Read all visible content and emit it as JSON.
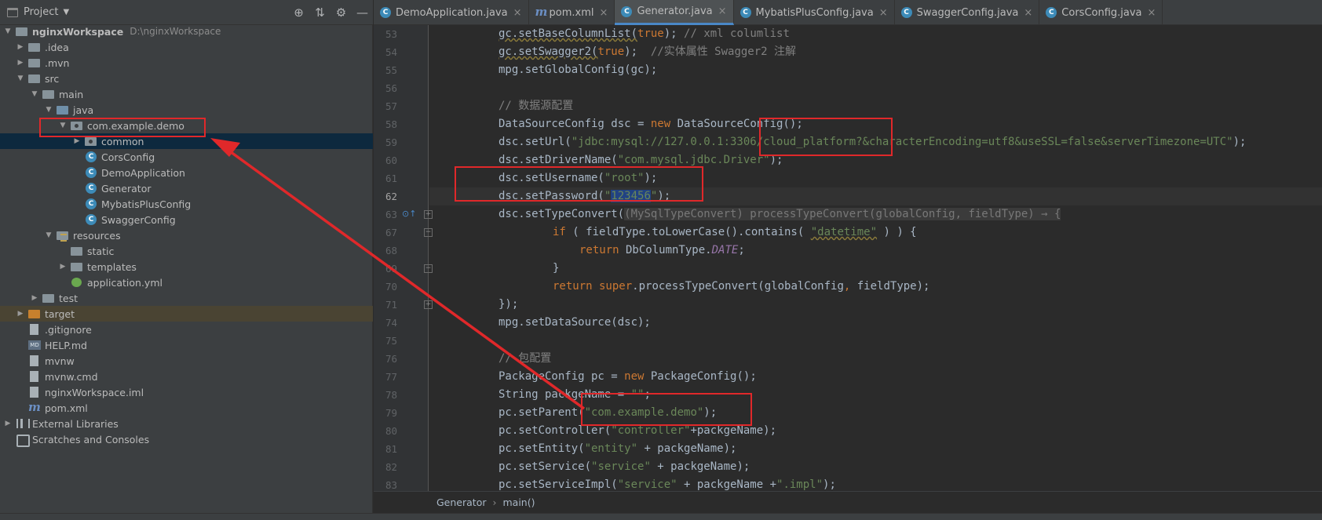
{
  "project_panel": {
    "title": "Project",
    "tools": [
      "locate-icon",
      "collapse-icon",
      "gear-icon",
      "minimize-icon"
    ]
  },
  "tree": [
    {
      "label": "nginxWorkspace",
      "sub": "D:\\nginxWorkspace"
    },
    {
      "label": ".idea"
    },
    {
      "label": ".mvn"
    },
    {
      "label": "src"
    },
    {
      "label": "main"
    },
    {
      "label": "java"
    },
    {
      "label": "com.example.demo"
    },
    {
      "label": "common"
    },
    {
      "label": "CorsConfig"
    },
    {
      "label": "DemoApplication"
    },
    {
      "label": "Generator"
    },
    {
      "label": "MybatisPlusConfig"
    },
    {
      "label": "SwaggerConfig"
    },
    {
      "label": "resources"
    },
    {
      "label": "static"
    },
    {
      "label": "templates"
    },
    {
      "label": "application.yml"
    },
    {
      "label": "test"
    },
    {
      "label": "target"
    },
    {
      "label": ".gitignore"
    },
    {
      "label": "HELP.md"
    },
    {
      "label": "mvnw"
    },
    {
      "label": "mvnw.cmd"
    },
    {
      "label": "nginxWorkspace.iml"
    },
    {
      "label": "pom.xml"
    },
    {
      "label": "External Libraries"
    },
    {
      "label": "Scratches and Consoles"
    }
  ],
  "tabs": [
    {
      "label": "DemoApplication.java"
    },
    {
      "label": "pom.xml"
    },
    {
      "label": "Generator.java"
    },
    {
      "label": "MybatisPlusConfig.java"
    },
    {
      "label": "SwaggerConfig.java"
    },
    {
      "label": "CorsConfig.java"
    }
  ],
  "line_numbers": [
    "53",
    "54",
    "55",
    "56",
    "57",
    "58",
    "59",
    "60",
    "61",
    "62",
    "63",
    "67",
    "68",
    "69",
    "70",
    "71",
    "74",
    "75",
    "76",
    "77",
    "78",
    "79",
    "80",
    "81",
    "82",
    "83"
  ],
  "code": {
    "l53a": "gc.setBaseColumnList(",
    "l53b": "true",
    "l53c": "); ",
    "l53d": "// xml columlist",
    "l54a": "gc.setSwagger2(",
    "l54b": "true",
    "l54c": ");  ",
    "l54d": "//实体属性 Swagger2 注解",
    "l55": "mpg.setGlobalConfig(gc);",
    "l57": "// 数据源配置",
    "l58a": "DataSourceConfig dsc = ",
    "l58b": "new",
    "l58c": " DataSourceConfig();",
    "l59a": "dsc.setUrl(",
    "l59b": "\"jdbc:mysql://127.0.0.1:3306/cloud_platform?&characterEncoding=utf8&useSSL=false&serverTimezone=UTC\"",
    "l59c": ");",
    "l60a": "dsc.setDriverName(",
    "l60b": "\"com.mysql.jdbc.Driver\"",
    "l60c": ");",
    "l61a": "dsc.setUsername(",
    "l61b": "\"root\"",
    "l61c": ");",
    "l62a": "dsc.setPassword(",
    "l62b": "\"",
    "l62c": "123456",
    "l62d": "\"",
    "l62e": ");",
    "l63a": "dsc.setTypeConvert(",
    "l63b": "(MySqlTypeConvert) processTypeConvert(globalConfig, fieldType) → {",
    "l67a": "if",
    "l67b": " ( fieldType.toLowerCase().contains( ",
    "l67c": "\"datetime\"",
    "l67d": " ) ) {",
    "l68a": "return",
    "l68b": " DbColumnType.",
    "l68c": "DATE",
    "l68d": ";",
    "l69": "}",
    "l70a": "return super",
    "l70b": ".processTypeConvert(globalConfig",
    "l70c": ",",
    "l70d": " fieldType);",
    "l71": "});",
    "l74": "mpg.setDataSource(dsc);",
    "l76": "// 包配置",
    "l77a": "PackageConfig pc = ",
    "l77b": "new",
    "l77c": " PackageConfig();",
    "l78a": "String packgeName = ",
    "l78b": "\"\"",
    "l78c": ";",
    "l79a": "pc.setParent(",
    "l79b": "\"com.example.demo\"",
    "l79c": ");",
    "l80a": "pc.setController(",
    "l80b": "\"controller\"",
    "l80c": "+packgeName);",
    "l81a": "pc.setEntity(",
    "l81b": "\"entity\"",
    "l81c": " + packgeName);",
    "l82a": "pc.setService(",
    "l82b": "\"service\"",
    "l82c": " + packgeName);",
    "l83a": "pc.setServiceImpl(",
    "l83b": "\"service\"",
    "l83c": " + packgeName +",
    "l83d": "\".impl\"",
    "l83e": ");"
  },
  "status_bar": {
    "class_name": "Generator",
    "separator": "›",
    "method_name": "main()"
  },
  "colors": {
    "annotation_red": "#e0282a",
    "selection_blue": "#0d293e",
    "active_tab_accent": "#4a88c7"
  }
}
